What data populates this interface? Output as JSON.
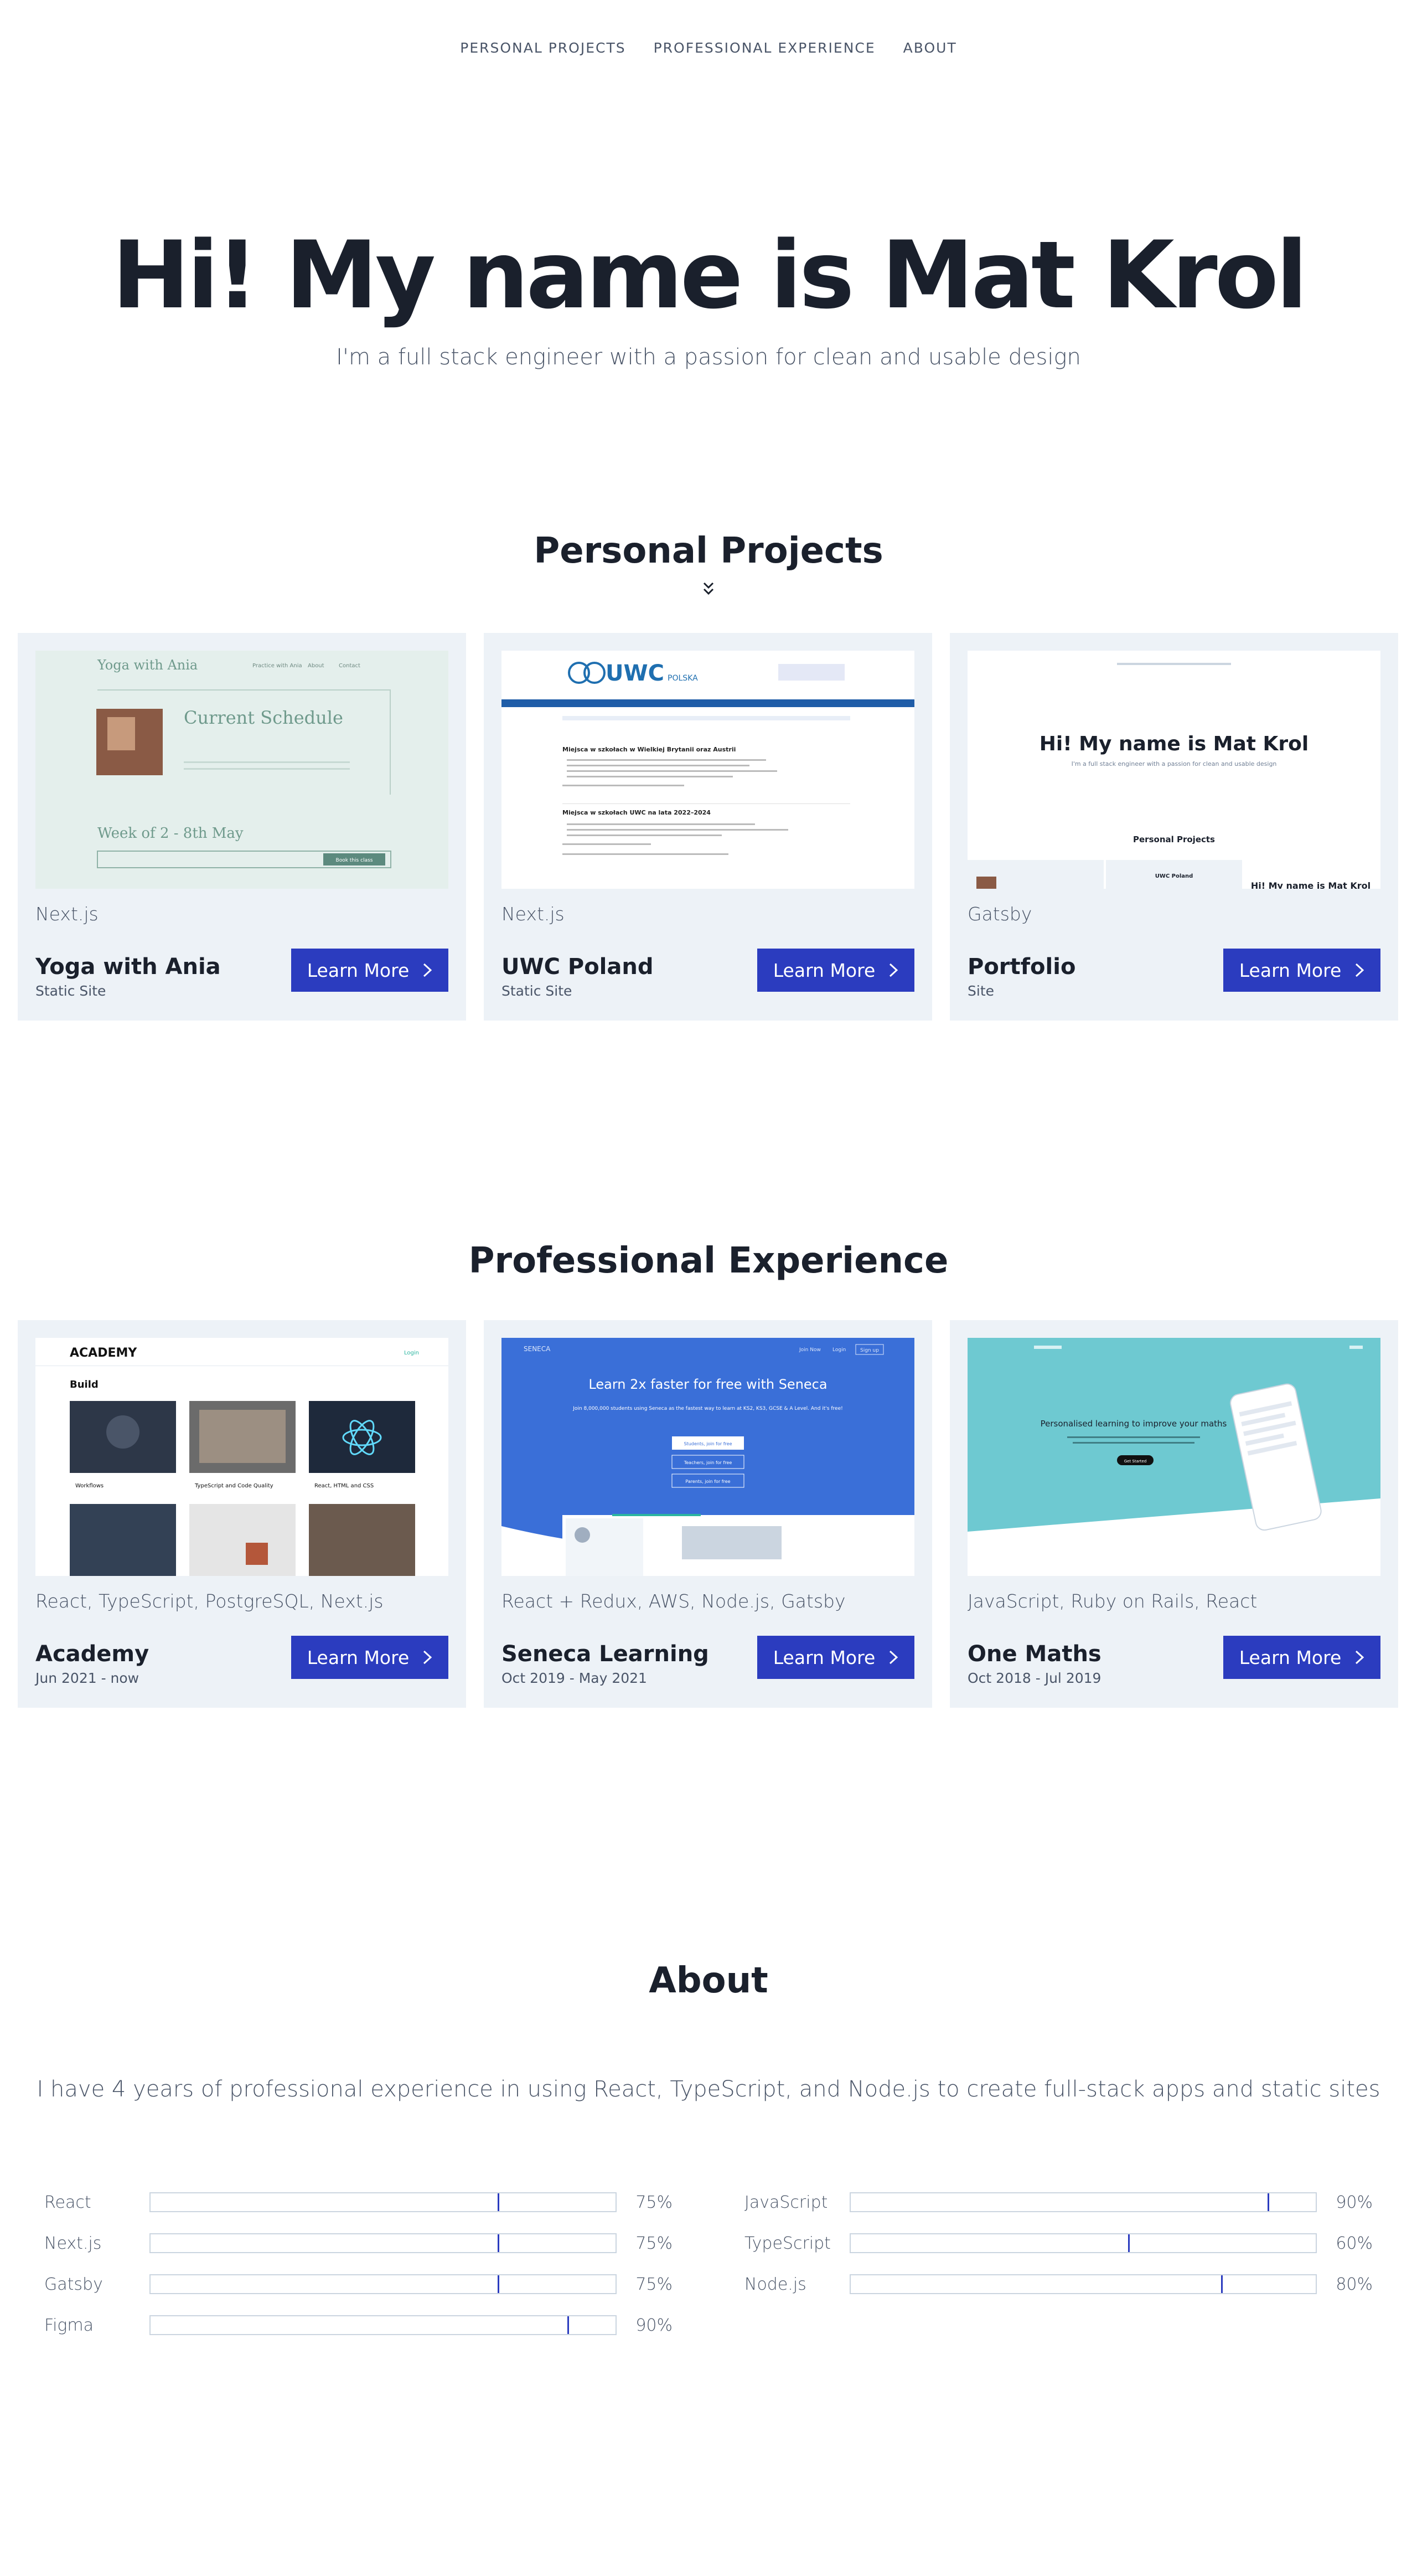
{
  "nav": {
    "items": [
      "PERSONAL PROJECTS",
      "PROFESSIONAL EXPERIENCE",
      "ABOUT"
    ]
  },
  "hero": {
    "title": "Hi! My name is Mat Krol",
    "subtitle": "I'm a full stack engineer with a passion for clean and usable design"
  },
  "personal": {
    "title": "Personal Projects",
    "cards": [
      {
        "tech": "Next.js",
        "name": "Yoga with Ania",
        "sub": "Static Site",
        "button": "Learn More"
      },
      {
        "tech": "Next.js",
        "name": "UWC Poland",
        "sub": "Static Site",
        "button": "Learn More"
      },
      {
        "tech": "Gatsby",
        "name": "Portfolio",
        "sub": "Site",
        "button": "Learn More"
      }
    ]
  },
  "thumbs": {
    "yoga": {
      "brand": "Yoga with Ania",
      "nav": [
        "Practice with Ania",
        "About",
        "Contact"
      ],
      "heading": "Current Schedule",
      "week": "Week of 2 - 8th May",
      "cta": "Book this class"
    },
    "uwc": {
      "logo": "UWC",
      "logo_sub": "POLSKA",
      "h1": "Miejsca w szkołach w Wielkiej Brytanii oraz Austrii",
      "h2": "Miejsca w szkołach UWC na lata 2022–2024"
    },
    "portfolio": {
      "title": "Hi! My name is Mat Krol",
      "subtitle": "I'm a full stack engineer with a passion for clean and usable design",
      "section": "Personal Projects",
      "card2": "UWC Poland",
      "card3": "Hi! My name is Mat Krol"
    },
    "academy": {
      "logo": "ACADEMY",
      "login": "Login",
      "heading": "Build",
      "items": [
        "Workflows",
        "TypeScript and Code Quality",
        "React, HTML and CSS"
      ]
    },
    "seneca": {
      "logo": "SENECA",
      "nav": [
        "Join Now",
        "Login",
        "Sign up"
      ],
      "heading": "Learn 2x faster for free with Seneca",
      "sub": "Join 8,000,000 students using Seneca as the fastest way to learn at KS2, KS3, GCSE & A Level. And it's free!",
      "buttons": [
        "Students, join for free",
        "Teachers, join for free",
        "Parents, join for free"
      ]
    },
    "maths": {
      "heading": "Personalised learning to improve your maths",
      "cta": "Get Started"
    }
  },
  "professional": {
    "title": "Professional Experience",
    "cards": [
      {
        "tech": "React, TypeScript, PostgreSQL, Next.js",
        "name": "Academy",
        "sub": "Jun 2021 - now",
        "button": "Learn More"
      },
      {
        "tech": "React + Redux, AWS, Node.js, Gatsby",
        "name": "Seneca Learning",
        "sub": "Oct 2019 - May 2021",
        "button": "Learn More"
      },
      {
        "tech": "JavaScript, Ruby on Rails, React",
        "name": "One Maths",
        "sub": "Oct 2018 - Jul 2019",
        "button": "Learn More"
      }
    ]
  },
  "about": {
    "title": "About",
    "text": "I have 4 years of professional experience in using React, TypeScript, and Node.js to create full-stack apps and static sites",
    "skills_left": [
      {
        "name": "React",
        "pct": "75%",
        "value": 0.75
      },
      {
        "name": "Next.js",
        "pct": "75%",
        "value": 0.75
      },
      {
        "name": "Gatsby",
        "pct": "75%",
        "value": 0.75
      },
      {
        "name": "Figma",
        "pct": "90%",
        "value": 0.9
      }
    ],
    "skills_right": [
      {
        "name": "JavaScript",
        "pct": "90%",
        "value": 0.9
      },
      {
        "name": "TypeScript",
        "pct": "60%",
        "value": 0.6
      },
      {
        "name": "Node.js",
        "pct": "80%",
        "value": 0.8
      }
    ]
  },
  "colors": {
    "accent": "#2b3cbf",
    "card_bg": "#edf2f7",
    "text": "#1a202c",
    "muted": "#4a5568"
  }
}
